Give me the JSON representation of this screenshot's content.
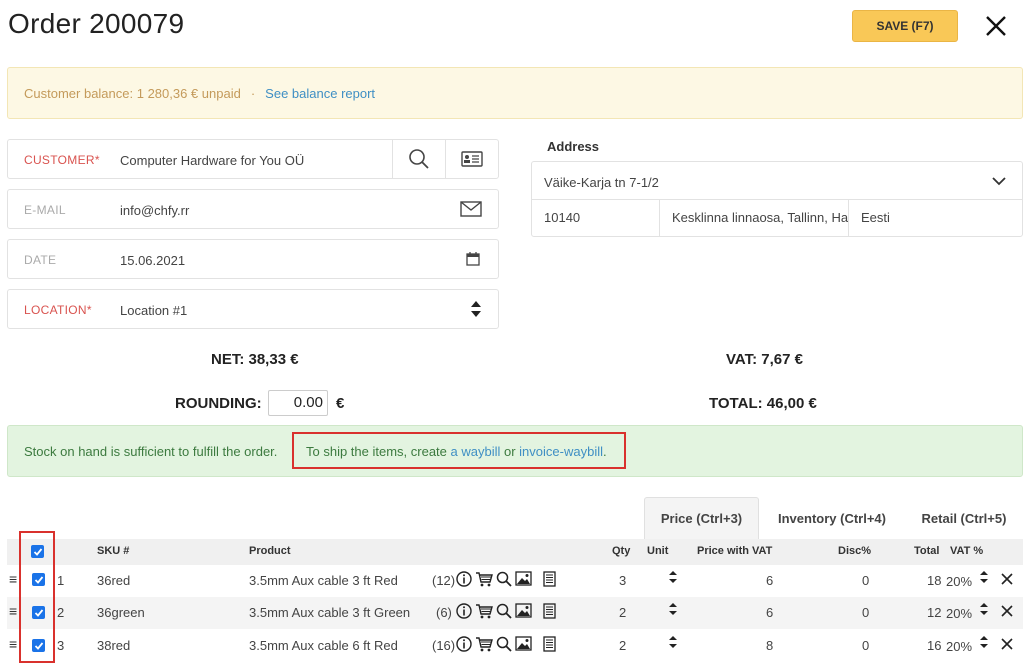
{
  "header": {
    "title": "Order 200079",
    "save_label": "SAVE (F7)"
  },
  "balance": {
    "text": "Customer balance: 1 280,36 € unpaid",
    "separator": "·",
    "link": "See balance report"
  },
  "form": {
    "customer": {
      "label": "CUSTOMER*",
      "value": "Computer Hardware for You OÜ"
    },
    "email": {
      "label": "E-MAIL",
      "value": "info@chfy.rr"
    },
    "date": {
      "label": "DATE",
      "value": "15.06.2021"
    },
    "location": {
      "label": "LOCATION*",
      "value": "Location #1"
    }
  },
  "address": {
    "title": "Address",
    "street": "Väike-Karja tn 7-1/2",
    "zip": "10140",
    "area": "Kesklinna linnaosa, Tallinn, Harjumaa",
    "country": "Eesti"
  },
  "totals": {
    "net": "NET: 38,33  €",
    "vat": "VAT: 7,67  €",
    "rounding_label": "ROUNDING:",
    "rounding_value": "0.00",
    "rounding_currency": "€",
    "total": "TOTAL: 46,00  €"
  },
  "stock": {
    "text1": "Stock on hand is sufficient to fulfill the order.",
    "text2": "To ship the items, create ",
    "link1": "a waybill",
    "or": " or ",
    "link2": "invoice-waybill",
    "end": "."
  },
  "tabs": [
    "Price (Ctrl+3)",
    "Inventory (Ctrl+4)",
    "Retail (Ctrl+5)"
  ],
  "table": {
    "headers": {
      "sku": "SKU #",
      "product": "Product",
      "qty": "Qty",
      "unit": "Unit",
      "price": "Price with VAT",
      "disc": "Disc%",
      "total": "Total",
      "vat": "VAT %"
    },
    "rows": [
      {
        "num": "1",
        "sku": "36red",
        "product": "3.5mm Aux cable 3 ft Red",
        "stock": "(12)",
        "qty": "3",
        "price": "6",
        "disc": "0",
        "total": "18",
        "vat": "20%"
      },
      {
        "num": "2",
        "sku": "36green",
        "product": "3.5mm Aux cable 3 ft Green",
        "stock": "(6)",
        "qty": "2",
        "price": "6",
        "disc": "0",
        "total": "12",
        "vat": "20%"
      },
      {
        "num": "3",
        "sku": "38red",
        "product": "3.5mm Aux cable 6 ft Red",
        "stock": "(16)",
        "qty": "2",
        "price": "8",
        "disc": "0",
        "total": "16",
        "vat": "20%"
      }
    ]
  },
  "colors": {
    "accent": "#f9c857",
    "link": "#3f8fc4",
    "required": "#d9534f",
    "success_bg": "#e3f4e0",
    "warning_bg": "#fdf8e4",
    "highlight": "#d9312d",
    "checkbox": "#1a73e8"
  },
  "icons": [
    "close-icon",
    "search-icon",
    "contact-card-icon",
    "envelope-icon",
    "calendar-icon",
    "sort-icon",
    "chevron-down-icon",
    "info-icon",
    "cart-icon",
    "image-icon",
    "document-icon",
    "drag-handle-icon",
    "checkbox-icon"
  ]
}
